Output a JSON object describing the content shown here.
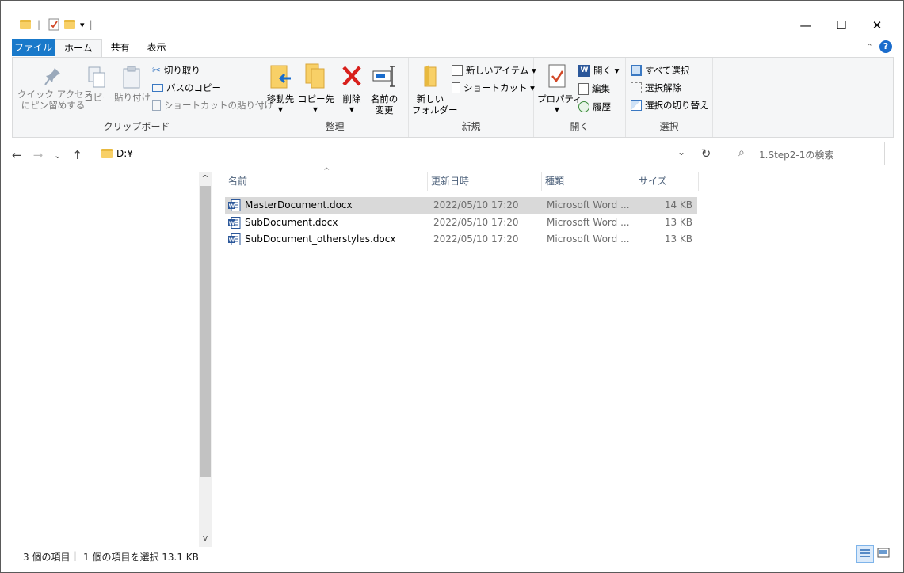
{
  "quick_access": {
    "separator": "|",
    "dropdown": "▾"
  },
  "window_controls": {
    "minimize": "—",
    "maximize": "☐",
    "close": "✕"
  },
  "tabs": {
    "file": "ファイル",
    "home": "ホーム",
    "share": "共有",
    "view": "表示"
  },
  "ribbon_chevron": "⌃",
  "help": "?",
  "clipboard": {
    "label": "クリップボード",
    "pin_line1": "クイック アクセス",
    "pin_line2": "にピン留めする",
    "copy": "コピー",
    "paste": "貼り付け",
    "cut": "切り取り",
    "copy_path": "パスのコピー",
    "paste_shortcut": "ショートカットの貼り付け"
  },
  "organize": {
    "label": "整理",
    "move_to": "移動先",
    "copy_to": "コピー先",
    "delete": "削除",
    "rename_line1": "名前の",
    "rename_line2": "変更"
  },
  "new": {
    "label": "新規",
    "new_folder_line1": "新しい",
    "new_folder_line2": "フォルダー",
    "new_item": "新しいアイテム ▾",
    "shortcut": "ショートカット ▾"
  },
  "open": {
    "label": "開く",
    "properties": "プロパティ",
    "open": "開く ▾",
    "edit": "編集",
    "history": "履歴"
  },
  "select": {
    "label": "選択",
    "select_all": "すべて選択",
    "select_none": "選択解除",
    "invert": "選択の切り替え"
  },
  "nav": {
    "back": "←",
    "forward": "→",
    "recent": "⌄",
    "up": "↑"
  },
  "address": {
    "value": "D:¥",
    "chevron": "⌄"
  },
  "refresh": "↻",
  "search": {
    "placeholder": "1.Step2-1の検索",
    "icon": "⌕"
  },
  "columns": {
    "name": "名前",
    "date": "更新日時",
    "type": "種類",
    "size": "サイズ",
    "sort": "^"
  },
  "files": [
    {
      "name": "MasterDocument.docx",
      "date": "2022/05/10 17:20",
      "type": "Microsoft Word ...",
      "size": "14 KB",
      "selected": true
    },
    {
      "name": "SubDocument.docx",
      "date": "2022/05/10 17:20",
      "type": "Microsoft Word ...",
      "size": "13 KB",
      "selected": false
    },
    {
      "name": "SubDocument_otherstyles.docx",
      "date": "2022/05/10 17:20",
      "type": "Microsoft Word ...",
      "size": "13 KB",
      "selected": false
    }
  ],
  "scroll": {
    "up": "^",
    "down": "v"
  },
  "status": {
    "count": "3 個の項目",
    "selected": "1 個の項目を選択  13.1 KB"
  },
  "colors": {
    "accent": "#1979ca",
    "selection": "#d9d9d9",
    "word_blue": "#2b579a"
  }
}
